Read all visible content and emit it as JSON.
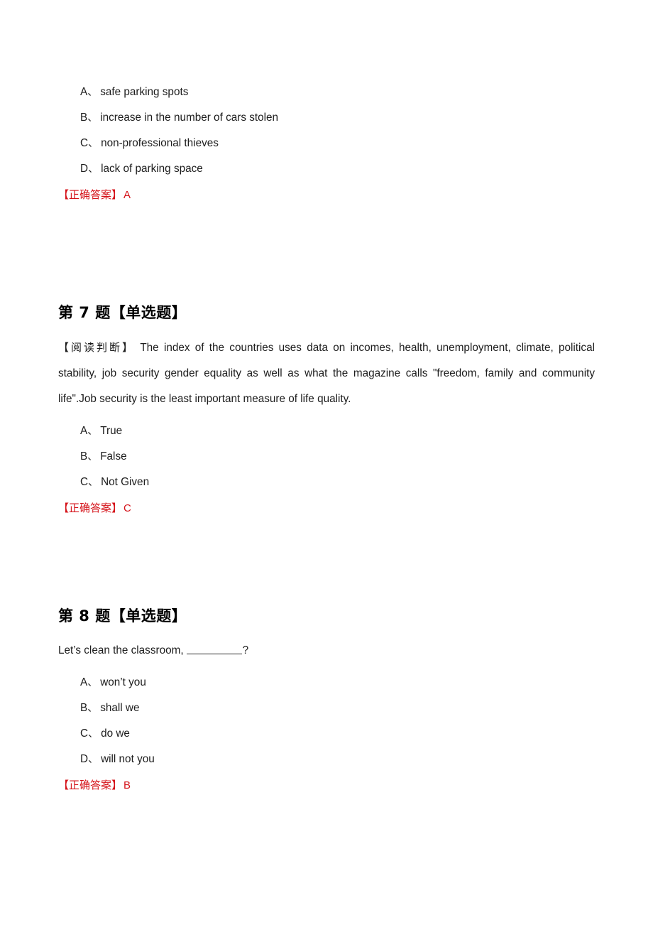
{
  "document": {
    "page_background": "#ffffff",
    "answer_color": "#d5131a",
    "text_color": "#1c1c1c"
  },
  "blocks": [
    {
      "id": "question-6-tail",
      "options": [
        {
          "key": "A",
          "sep": "、",
          "text": "safe parking spots"
        },
        {
          "key": "B",
          "sep": "、",
          "text": "increase in the number of cars stolen"
        },
        {
          "key": "C",
          "sep": "、",
          "text": "non-professional thieves"
        },
        {
          "key": "D",
          "sep": "、",
          "text": "lack of parking space"
        }
      ],
      "answer": {
        "label": "【正确答案】",
        "value": "A"
      }
    },
    {
      "id": "question-7",
      "header": "第 7 题【单选题】",
      "stem_tag": "【阅读判断】",
      "stem_text": " The index of the countries uses data on incomes, health, unemployment, climate, political stability, job security gender equality as well as what the magazine calls \"freedom, family and community life\".Job security is the least important measure of life quality.",
      "options": [
        {
          "key": "A",
          "sep": "、",
          "text": "True"
        },
        {
          "key": "B",
          "sep": "、",
          "text": "False"
        },
        {
          "key": "C",
          "sep": "、",
          "text": "Not Given"
        }
      ],
      "answer": {
        "label": "【正确答案】",
        "value": "C"
      }
    },
    {
      "id": "question-8",
      "header": "第 8 题【单选题】",
      "stem_prefix": "Let’s clean the classroom,",
      "stem_suffix": "?",
      "options": [
        {
          "key": "A",
          "sep": "、",
          "text": "won’t you"
        },
        {
          "key": "B",
          "sep": "、",
          "text": "shall we"
        },
        {
          "key": "C",
          "sep": "、",
          "text": "do we"
        },
        {
          "key": "D",
          "sep": "、",
          "text": "will not you"
        }
      ],
      "answer": {
        "label": "【正确答案】",
        "value": "B"
      }
    }
  ]
}
